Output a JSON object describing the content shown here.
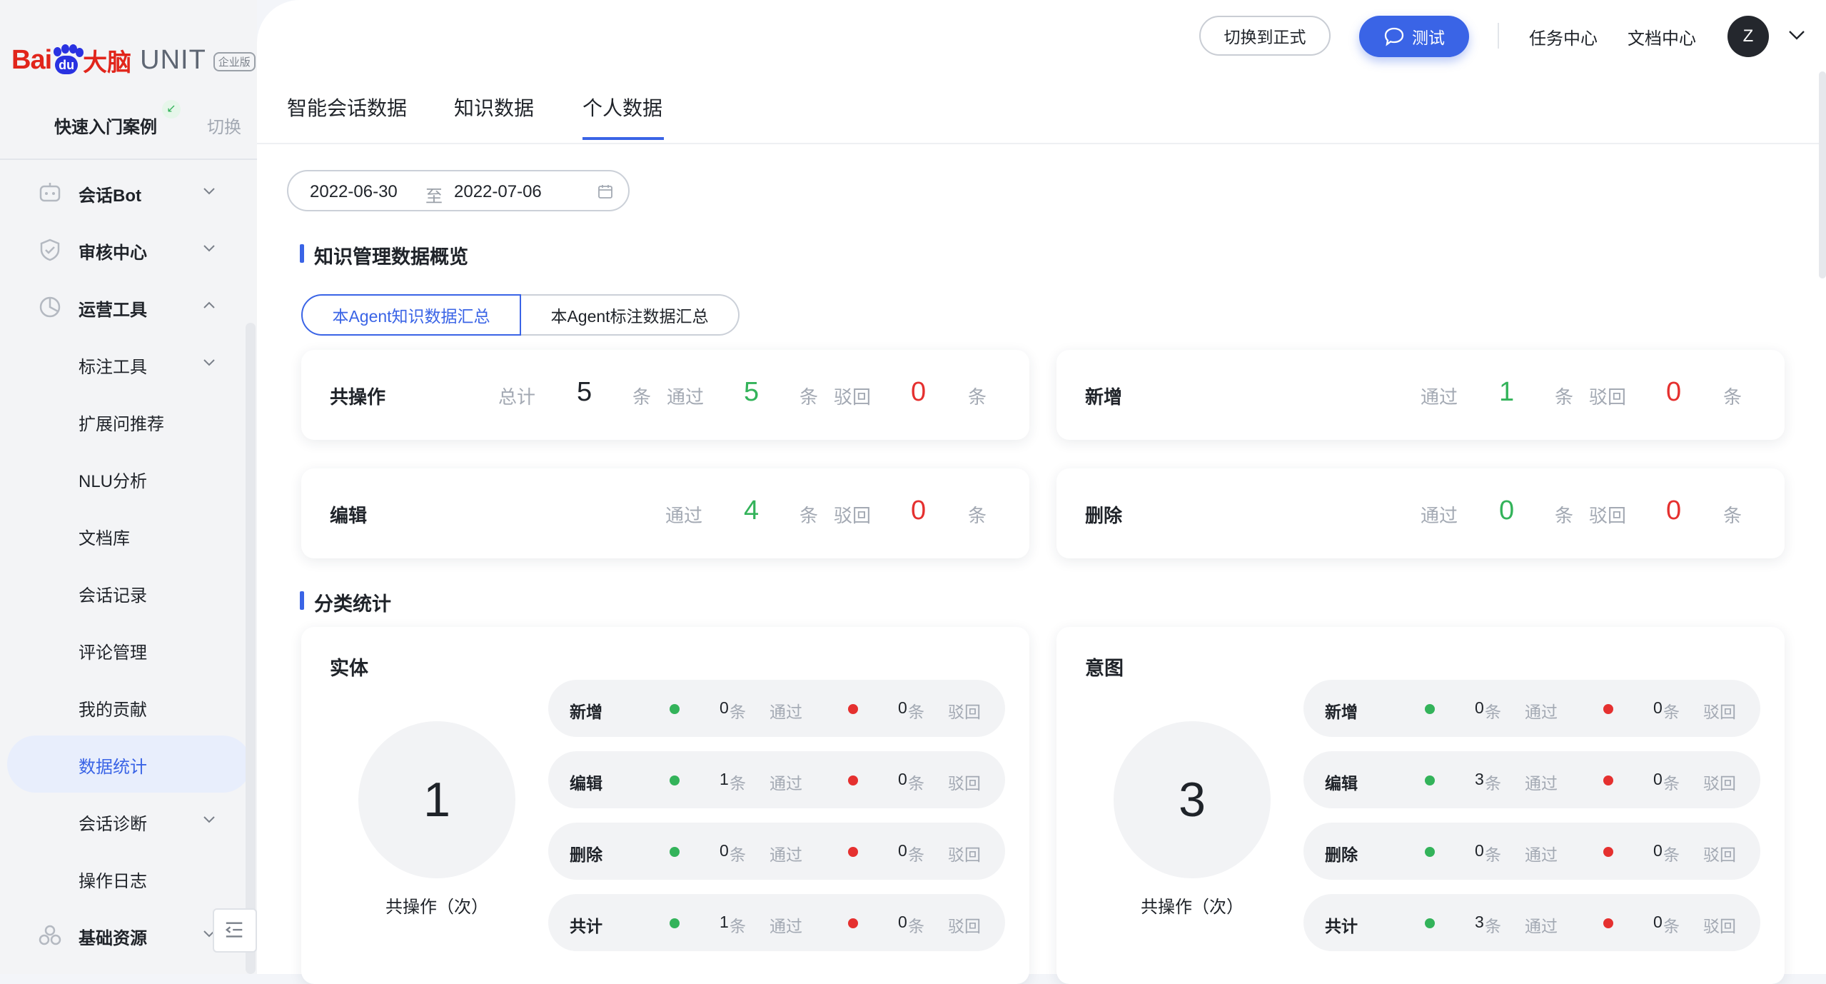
{
  "brand": {
    "bai": "Bai",
    "du": "du",
    "danao": "大脑",
    "unit": "UNIT",
    "edition": "企业版"
  },
  "quick_start": {
    "label": "快速入门案例",
    "switch": "切换"
  },
  "menu": [
    {
      "label": "会话Bot",
      "level": "top",
      "icon": "robot-icon",
      "chevron": "down"
    },
    {
      "label": "审核中心",
      "level": "top",
      "icon": "shield-icon",
      "chevron": "down"
    },
    {
      "label": "运营工具",
      "level": "top",
      "icon": "chart-pie-icon",
      "chevron": "up"
    },
    {
      "label": "标注工具",
      "level": "sub",
      "chevron": "down"
    },
    {
      "label": "扩展问推荐",
      "level": "sub"
    },
    {
      "label": "NLU分析",
      "level": "sub"
    },
    {
      "label": "文档库",
      "level": "sub"
    },
    {
      "label": "会话记录",
      "level": "sub"
    },
    {
      "label": "评论管理",
      "level": "sub"
    },
    {
      "label": "我的贡献",
      "level": "sub"
    },
    {
      "label": "数据统计",
      "level": "sub",
      "active": true
    },
    {
      "label": "会话诊断",
      "level": "sub",
      "chevron": "down"
    },
    {
      "label": "操作日志",
      "level": "sub"
    },
    {
      "label": "基础资源",
      "level": "top",
      "icon": "cubes-icon",
      "chevron": "down"
    }
  ],
  "topbar": {
    "switch_formal": "切换到正式",
    "test": "测试",
    "task_center": "任务中心",
    "doc_center": "文档中心",
    "avatar_letter": "Z"
  },
  "tabs": [
    "智能会话数据",
    "知识数据",
    "个人数据"
  ],
  "active_tab": "个人数据",
  "date_range": {
    "start": "2022-06-30",
    "sep": "至",
    "end": "2022-07-06"
  },
  "section1_title": "知识管理数据概览",
  "segments": [
    "本Agent知识数据汇总",
    "本Agent标注数据汇总"
  ],
  "labels": {
    "total": "总计",
    "pass": "通过",
    "reject": "驳回",
    "unit": "条"
  },
  "overview": {
    "all": {
      "title": "共操作",
      "total": "5",
      "pass": "5",
      "reject": "0"
    },
    "add": {
      "title": "新增",
      "pass": "1",
      "reject": "0"
    },
    "edit": {
      "title": "编辑",
      "pass": "4",
      "reject": "0"
    },
    "delete": {
      "title": "删除",
      "pass": "0",
      "reject": "0"
    }
  },
  "section2_title": "分类统计",
  "categories": {
    "entity": {
      "title": "实体",
      "count": "1",
      "count_label": "共操作（次）",
      "rows": [
        {
          "label": "新增",
          "pass": "0",
          "reject": "0"
        },
        {
          "label": "编辑",
          "pass": "1",
          "reject": "0"
        },
        {
          "label": "删除",
          "pass": "0",
          "reject": "0"
        },
        {
          "label": "共计",
          "pass": "1",
          "reject": "0"
        }
      ]
    },
    "intent": {
      "title": "意图",
      "count": "3",
      "count_label": "共操作（次）",
      "rows": [
        {
          "label": "新增",
          "pass": "0",
          "reject": "0"
        },
        {
          "label": "编辑",
          "pass": "3",
          "reject": "0"
        },
        {
          "label": "删除",
          "pass": "0",
          "reject": "0"
        },
        {
          "label": "共计",
          "pass": "3",
          "reject": "0"
        }
      ]
    }
  },
  "colors": {
    "primary": "#3a64e6",
    "pass": "#33b35a",
    "reject": "#e5302f",
    "brand_red": "#e1251b",
    "brand_blue": "#2932e1"
  }
}
